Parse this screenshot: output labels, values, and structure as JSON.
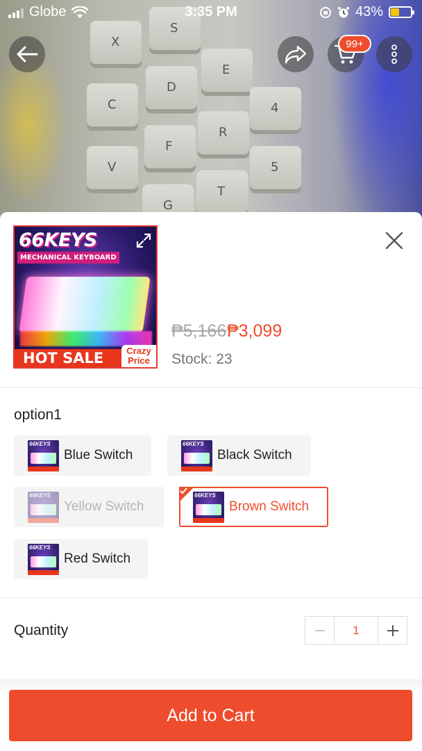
{
  "status_bar": {
    "carrier": "Globe",
    "time": "3:35 PM",
    "battery": "43%",
    "battery_level": 0.43
  },
  "nav": {
    "cart_badge": "99+"
  },
  "product": {
    "thumb_brand": "66KEYS",
    "thumb_subtitle": "MECHANICAL KEYBOARD",
    "thumb_hot_sale": "HOT SALE",
    "thumb_crazy_price_1": "Crazy",
    "thumb_crazy_price_2": "Price",
    "original_price": "₱5,166",
    "sale_price": "₱3,099",
    "stock": "Stock: 23"
  },
  "options": {
    "title": "option1",
    "variant_thumb_brand": "66KEYS",
    "items": [
      {
        "label": "Blue Switch",
        "state": "normal"
      },
      {
        "label": "Black Switch",
        "state": "normal"
      },
      {
        "label": "Yellow Switch",
        "state": "disabled"
      },
      {
        "label": "Brown Switch",
        "state": "selected"
      },
      {
        "label": "Red Switch",
        "state": "normal"
      }
    ]
  },
  "quantity": {
    "label": "Quantity",
    "value": "1"
  },
  "actions": {
    "add_to_cart": "Add to Cart"
  },
  "colors": {
    "accent": "#ee4d2d",
    "badge": "#ee4d2d",
    "battery": "#f5c400"
  },
  "icons": [
    "back-arrow-icon",
    "share-icon",
    "cart-icon",
    "more-vertical-icon",
    "expand-icon",
    "close-icon",
    "minus-icon",
    "plus-icon",
    "check-icon",
    "wifi-icon",
    "alarm-icon",
    "rotation-lock-icon"
  ]
}
